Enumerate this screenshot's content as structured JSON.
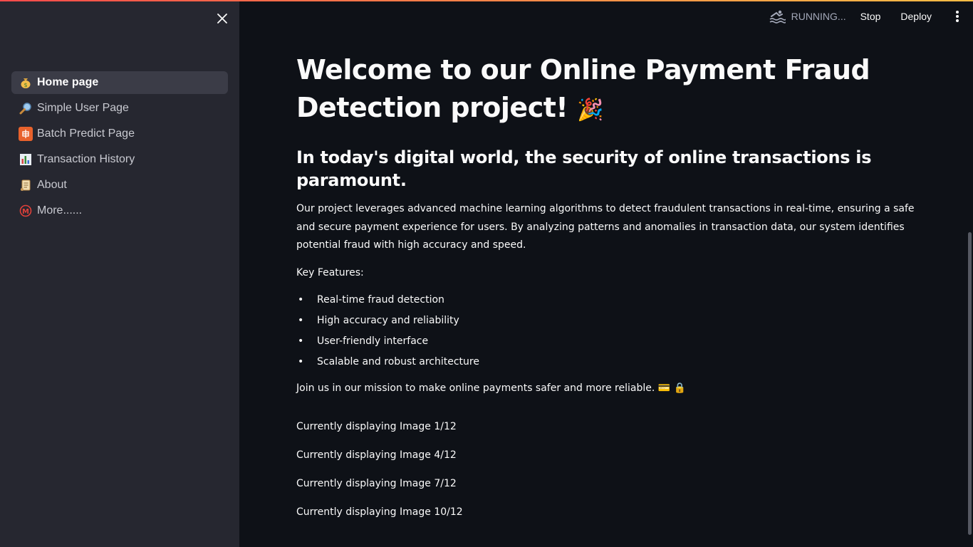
{
  "header": {
    "status": "RUNNING...",
    "stop_label": "Stop",
    "deploy_label": "Deploy"
  },
  "sidebar": {
    "items": [
      {
        "label": "Home page",
        "icon": "money-bag-icon",
        "active": true
      },
      {
        "label": "Simple User Page",
        "icon": "magnifier-icon",
        "active": false
      },
      {
        "label": "Batch Predict Page",
        "icon": "batch-icon",
        "active": false
      },
      {
        "label": "Transaction History",
        "icon": "bar-chart-icon",
        "active": false
      },
      {
        "label": "About",
        "icon": "scroll-icon",
        "active": false
      },
      {
        "label": "More......",
        "icon": "circled-m-icon",
        "active": false
      }
    ]
  },
  "main": {
    "title": "Welcome to our Online Payment Fraud Detection project!",
    "title_emoji": "🎉",
    "subtitle": "In today's digital world, the security of online transactions is paramount.",
    "intro": "Our project leverages advanced machine learning algorithms to detect fraudulent transactions in real-time, ensuring a safe and secure payment experience for users. By analyzing patterns and anomalies in transaction data, our system identifies potential fraud with high accuracy and speed.",
    "key_features_label": "Key Features:",
    "features": [
      "Real-time fraud detection",
      "High accuracy and reliability",
      "User-friendly interface",
      "Scalable and robust architecture"
    ],
    "join": "Join us in our mission to make online payments safer and more reliable. 💳 🔒",
    "image_status": [
      "Currently displaying Image 1/12",
      "Currently displaying Image 4/12",
      "Currently displaying Image 7/12",
      "Currently displaying Image 10/12"
    ]
  },
  "colors": {
    "background": "#0e1117",
    "sidebar": "#262730",
    "active_item": "#3b3c47",
    "accent_gradient_start": "#ff4b4b",
    "accent_gradient_end": "#ffbd45"
  }
}
